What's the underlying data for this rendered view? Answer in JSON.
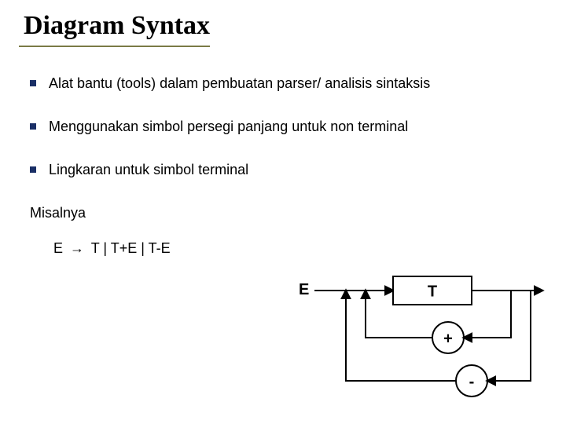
{
  "title": "Diagram Syntax",
  "bullets": {
    "b1": "Alat bantu (tools) dalam pembuatan parser/ analisis sintaksis",
    "b2": "Menggunakan simbol persegi panjang untuk non terminal",
    "b3": "Lingkaran untuk simbol terminal"
  },
  "example_label": "Misalnya",
  "grammar": {
    "lhs": "E",
    "arrow": "→",
    "rhs": "T | T+E | T-E"
  },
  "diagram": {
    "E": "E",
    "T": "T",
    "plus": "+",
    "minus": "-"
  }
}
